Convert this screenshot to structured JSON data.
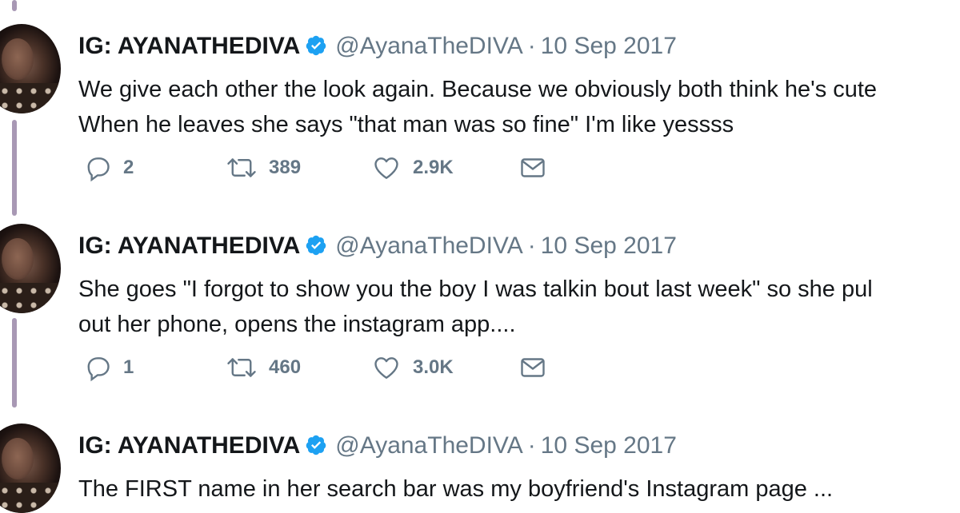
{
  "tweets": [
    {
      "name": "IG: AYANATHEDIVA",
      "handle": "@AyanaTheDIVA",
      "separator": "·",
      "date": "10 Sep 2017",
      "lines": [
        "We give each other the look again. Because we obviously both think he's cute",
        "When he leaves she says \"that man was so fine\" I'm like yessss"
      ],
      "replies": "2",
      "retweets": "389",
      "likes": "2.9K"
    },
    {
      "name": "IG: AYANATHEDIVA",
      "handle": "@AyanaTheDIVA",
      "separator": "·",
      "date": "10 Sep 2017",
      "lines": [
        "She goes \"I forgot to show you the boy I was talkin bout last week\" so she pul",
        "out her phone, opens the instagram app...."
      ],
      "replies": "1",
      "retweets": "460",
      "likes": "3.0K"
    },
    {
      "name": "IG: AYANATHEDIVA",
      "handle": "@AyanaTheDIVA",
      "separator": "·",
      "date": "10 Sep 2017",
      "lines": [
        "The FIRST name in her search bar was my boyfriend's Instagram page ..."
      ]
    }
  ],
  "icons": {
    "reply": "reply-icon",
    "retweet": "retweet-icon",
    "like": "heart-icon",
    "message": "envelope-icon",
    "verified": "verified-badge-icon"
  },
  "colors": {
    "verified_blue": "#1da1f2",
    "muted_text": "#657786",
    "thread_line": "#a898b4"
  }
}
